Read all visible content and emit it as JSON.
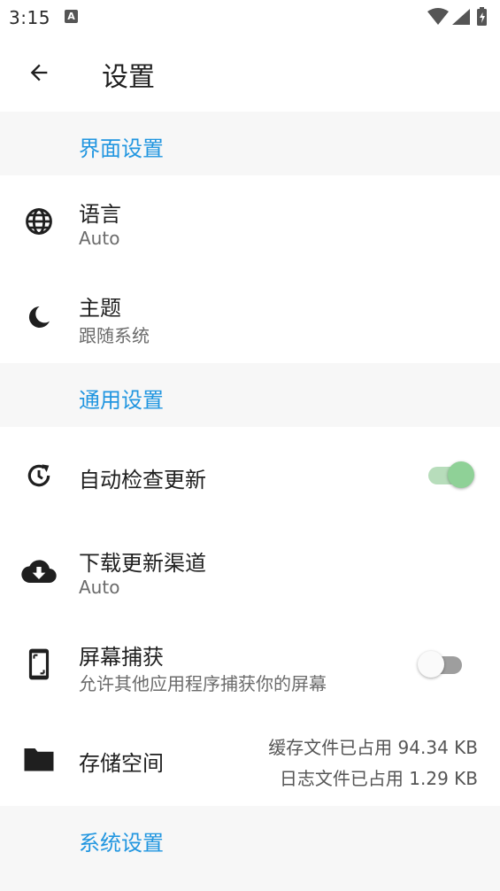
{
  "status_bar": {
    "time": "3:15",
    "notification_badge": "A",
    "icons": [
      "wifi-icon",
      "cell-signal-icon",
      "battery-charging-icon"
    ]
  },
  "app_bar": {
    "title": "设置",
    "back_icon": "arrow-left-icon"
  },
  "sections": {
    "interface": {
      "header": "界面设置",
      "language": {
        "title": "语言",
        "value": "Auto",
        "icon": "globe-icon"
      },
      "theme": {
        "title": "主题",
        "value": "跟随系统",
        "icon": "moon-icon"
      }
    },
    "general": {
      "header": "通用设置",
      "auto_update": {
        "title": "自动检查更新",
        "enabled": true,
        "icon": "update-clock-icon"
      },
      "update_channel": {
        "title": "下载更新渠道",
        "value": "Auto",
        "icon": "cloud-download-icon"
      },
      "screen_capture": {
        "title": "屏幕捕获",
        "description": "允许其他应用程序捕获你的屏幕",
        "enabled": false,
        "icon": "phone-screenshot-icon"
      },
      "storage": {
        "title": "存储空间",
        "cache_info": "缓存文件已占用 94.34 KB",
        "log_info": "日志文件已占用 1.29 KB",
        "icon": "folder-icon"
      }
    },
    "system": {
      "header": "系统设置"
    }
  },
  "colors": {
    "accent": "#2196e0",
    "switch_on_thumb": "#8fd197",
    "switch_on_track": "#b7ddbb",
    "section_bg": "#f7f7f7"
  }
}
